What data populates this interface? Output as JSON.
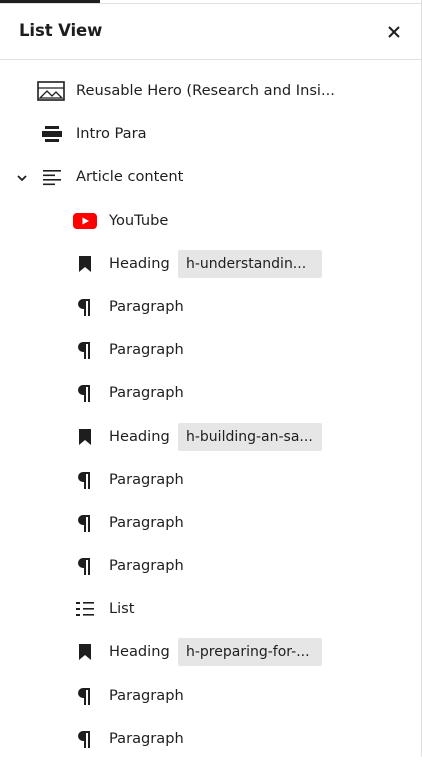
{
  "panel": {
    "title": "List View",
    "close_label": "×"
  },
  "colors": {
    "youtube_red": "#ff0000",
    "anchor_bg": "#e6e6e6",
    "text": "#1e1e1e"
  },
  "blocks": [
    {
      "label": "Reusable Hero (Research and Insi...",
      "icon": "image-icon"
    },
    {
      "label": "Intro Para",
      "icon": "block-icon"
    },
    {
      "label": "Article content",
      "icon": "paragraph-lines-icon",
      "expanded": true
    },
    {
      "label": "YouTube",
      "icon": "youtube-icon"
    },
    {
      "label": "Heading",
      "icon": "bookmark-icon",
      "anchor": "h-understandin..."
    },
    {
      "label": "Paragraph",
      "icon": "pilcrow-icon"
    },
    {
      "label": "Paragraph",
      "icon": "pilcrow-icon"
    },
    {
      "label": "Paragraph",
      "icon": "pilcrow-icon"
    },
    {
      "label": "Heading",
      "icon": "bookmark-icon",
      "anchor": "h-building-an-sa..."
    },
    {
      "label": "Paragraph",
      "icon": "pilcrow-icon"
    },
    {
      "label": "Paragraph",
      "icon": "pilcrow-icon"
    },
    {
      "label": "Paragraph",
      "icon": "pilcrow-icon"
    },
    {
      "label": "List",
      "icon": "list-icon"
    },
    {
      "label": "Heading",
      "icon": "bookmark-icon",
      "anchor": "h-preparing-for-..."
    },
    {
      "label": "Paragraph",
      "icon": "pilcrow-icon"
    },
    {
      "label": "Paragraph",
      "icon": "pilcrow-icon"
    }
  ]
}
